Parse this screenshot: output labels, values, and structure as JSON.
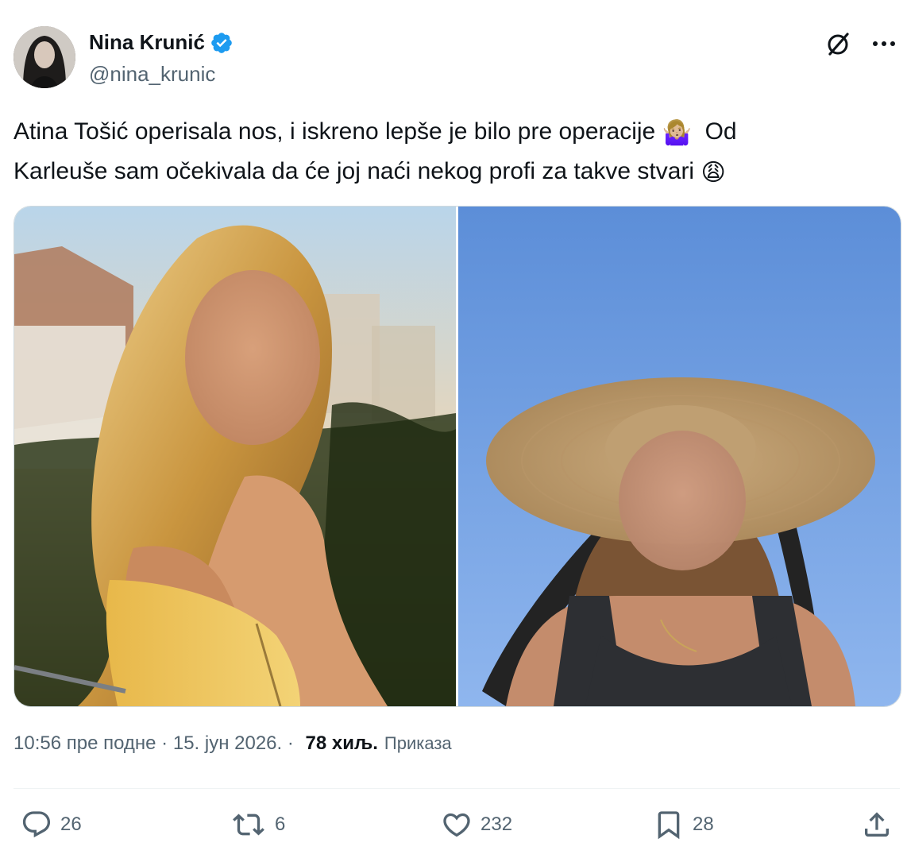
{
  "author": {
    "display_name": "Nina Krunić",
    "handle": "@nina_krunic",
    "verified": true
  },
  "header_icons": [
    "grok-icon",
    "more-icon"
  ],
  "tweet": {
    "line1_text": "Atina Tošić operisala nos, i iskreno lepše je bilo pre operacije ",
    "line1_emoji": "🤷🏼‍♀️",
    "line1_tail": "  Od",
    "line2_text": "Karleuše sam očekivala da će joj naći nekog profi za takve stvari ",
    "line2_emoji": "😩"
  },
  "media": {
    "count": 2,
    "images": [
      "photo-blonde-woman-yellow-dress",
      "photo-woman-straw-hat"
    ]
  },
  "meta": {
    "time": "10:56 пре подне",
    "sep1": " · ",
    "date": "15. јун 2026.",
    "sep2": " · ",
    "views_count": "78 хиљ.",
    "views_label": "Приказа"
  },
  "actions": {
    "replies": "26",
    "reposts": "6",
    "likes": "232",
    "bookmarks": "28"
  },
  "colors": {
    "text_primary": "#0f1419",
    "text_secondary": "#536471",
    "verified_blue": "#1d9bf0"
  }
}
